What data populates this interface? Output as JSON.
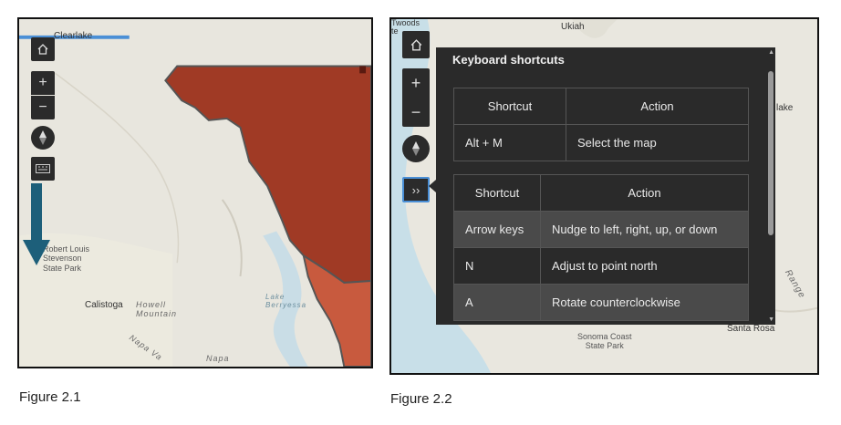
{
  "figure1": {
    "caption": "Figure 2.1",
    "map_labels": {
      "clearlake": "Clearlake",
      "park": "Robert Louis\nStevenson\nState Park",
      "calistoga": "Calistoga",
      "howell": "Howell\nMountain",
      "lake": "Lake\nBerryessa",
      "napa_valley": "Napa Va",
      "napa": "Napa"
    },
    "controls": {
      "home_icon": "home-icon",
      "zoom_in": "+",
      "zoom_out": "−",
      "compass_icon": "compass-icon",
      "keyboard_icon": "keyboard-icon"
    },
    "colors": {
      "region_dark": "#a03a25",
      "region_light": "#c85a3e",
      "indicator_arrow": "#1d5f7a",
      "loading_bar": "#4a8fd6"
    }
  },
  "figure2": {
    "caption": "Figure 2.2",
    "map_labels": {
      "woods": "Twoods\nte",
      "ukiah": "Ukiah",
      "lake": "lake",
      "range": "Range",
      "santa_rosa": "Santa Rosa",
      "sonoma": "Sonoma Coast\nState Park"
    },
    "controls": {
      "home_icon": "home-icon",
      "zoom_in": "+",
      "zoom_out": "−",
      "compass_icon": "compass-icon",
      "expand_label": "››"
    },
    "panel": {
      "title": "Keyboard shortcuts",
      "table1": {
        "headers": [
          "Shortcut",
          "Action"
        ],
        "rows": [
          [
            "Alt + M",
            "Select the map"
          ]
        ]
      },
      "table2": {
        "headers": [
          "Shortcut",
          "Action"
        ],
        "rows": [
          [
            "Arrow keys",
            "Nudge to left, right, up, or down"
          ],
          [
            "N",
            "Adjust to point north"
          ],
          [
            "A",
            "Rotate counterclockwise"
          ]
        ]
      }
    }
  }
}
